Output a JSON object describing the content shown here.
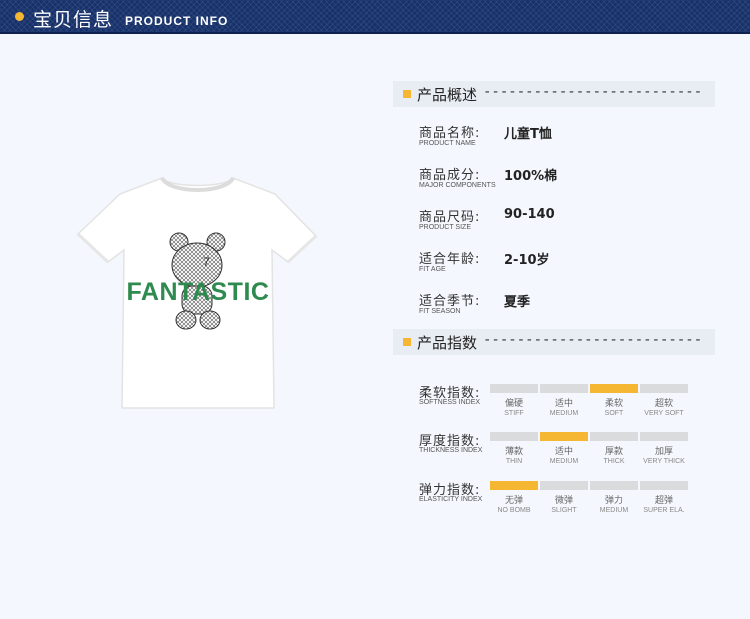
{
  "header": {
    "title_cn": "宝贝信息",
    "title_en": "PRODUCT INFO",
    "accent": "#f5b731",
    "background": "#17316b"
  },
  "product_image": {
    "print_text": "FANTASTIC",
    "print_color": "#2e8a4e"
  },
  "overview": {
    "title": "产品概述",
    "dashes": "--------------------------",
    "rows": [
      {
        "label_cn": "商品名称:",
        "label_en": "PRODUCT NAME",
        "value": "儿童T恤"
      },
      {
        "label_cn": "商品成分:",
        "label_en": "MAJOR COMPONENTS",
        "value": "100%棉"
      },
      {
        "label_cn": "商品尺码:",
        "label_en": "PRODUCT SIZE",
        "value": "90-140"
      },
      {
        "label_cn": "适合年龄:",
        "label_en": "FIT AGE",
        "value": "2-10岁"
      },
      {
        "label_cn": "适合季节:",
        "label_en": "FIT SEASON",
        "value": "夏季"
      }
    ]
  },
  "indices": {
    "title": "产品指数",
    "dashes": "--------------------------",
    "rows": [
      {
        "label_cn": "柔软指数:",
        "label_en": "SOFTNESS INDEX",
        "selected": 2,
        "options": [
          {
            "cn": "偏硬",
            "en": "STIFF"
          },
          {
            "cn": "适中",
            "en": "MEDIUM"
          },
          {
            "cn": "柔软",
            "en": "SOFT"
          },
          {
            "cn": "超软",
            "en": "VERY SOFT"
          }
        ]
      },
      {
        "label_cn": "厚度指数:",
        "label_en": "THICKNESS INDEX",
        "selected": 1,
        "options": [
          {
            "cn": "薄款",
            "en": "THIN"
          },
          {
            "cn": "适中",
            "en": "MEDIUM"
          },
          {
            "cn": "厚款",
            "en": "THICK"
          },
          {
            "cn": "加厚",
            "en": "VERY THICK"
          }
        ]
      },
      {
        "label_cn": "弹力指数:",
        "label_en": "ELASTICITY INDEX",
        "selected": 0,
        "options": [
          {
            "cn": "无弹",
            "en": "NO BOMB"
          },
          {
            "cn": "微弹",
            "en": "SLIGHT"
          },
          {
            "cn": "弹力",
            "en": "MEDIUM"
          },
          {
            "cn": "超弹",
            "en": "SUPER ELA."
          }
        ]
      }
    ]
  }
}
